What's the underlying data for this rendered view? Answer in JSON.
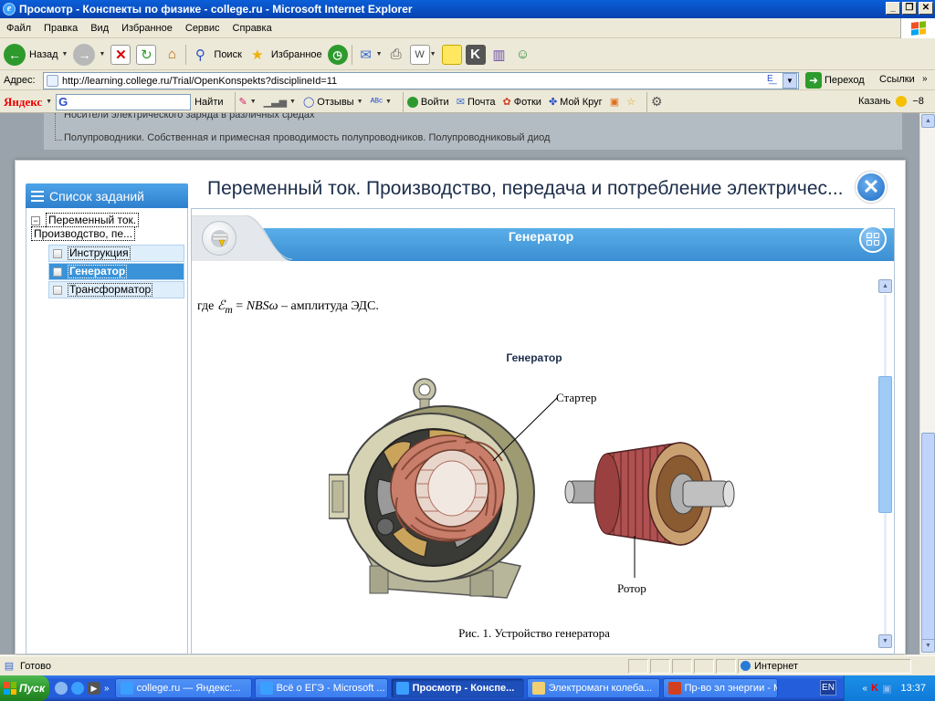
{
  "window": {
    "title": "Просмотр - Конспекты по физике - college.ru - Microsoft Internet Explorer"
  },
  "menu": [
    "Файл",
    "Правка",
    "Вид",
    "Избранное",
    "Сервис",
    "Справка"
  ],
  "toolbar": {
    "back": "Назад",
    "search": "Поиск",
    "favorites": "Избранное"
  },
  "address": {
    "label": "Адрес:",
    "url": "http://learning.college.ru/Trial/OpenKonspekts?disciplineId=11",
    "go": "Переход",
    "links": "Ссылки"
  },
  "yandex": {
    "logo": "Яндекс",
    "find": "Найти",
    "reviews": "Отзывы",
    "login": "Войти",
    "mail": "Почта",
    "photos": "Фотки",
    "circle": "Мой Круг",
    "city": "Казань",
    "temp": "−8"
  },
  "background_page": {
    "line1": "Носители электрического заряда в различных средах",
    "line2": "Полупроводники. Собственная и примесная проводимость полупроводников. Полупроводниковый диод"
  },
  "dialog": {
    "title": "Переменный ток. Производство, передача и потребление электричес...",
    "sidebar_title": "Список заданий",
    "topic_line1": "Переменный ток.",
    "topic_line2": "Производство, пе...",
    "tasks": [
      "Инструкция",
      "Генератор",
      "Трансформатор"
    ],
    "selected_task": 1,
    "content_title": "Генератор"
  },
  "content": {
    "formula_prefix": "где ",
    "formula_sym": "ℰ",
    "formula_sub": "m",
    "formula_eq": " = ",
    "formula_expr": "NBSω",
    "formula_suffix": " – амплитуда ЭДС.",
    "figure_title": "Генератор",
    "label_stator": "Стартер",
    "label_rotor": "Ротор",
    "caption": "Рис. 1. Устройство генератора"
  },
  "status": {
    "text": "Готово",
    "zone": "Интернет"
  },
  "taskbar": {
    "start": "Пуск",
    "tasks": [
      "college.ru — Яндекс:...",
      "Всё о ЕГЭ - Microsoft ...",
      "Просмотр - Конспе...",
      "Электромагн колеба...",
      "Пр-во эл энергии - Mi..."
    ],
    "active_task": 2,
    "lang": "EN",
    "time": "13:37"
  },
  "colors": {
    "accent": "#3a93d8",
    "title_text": "#1c2d4a"
  }
}
